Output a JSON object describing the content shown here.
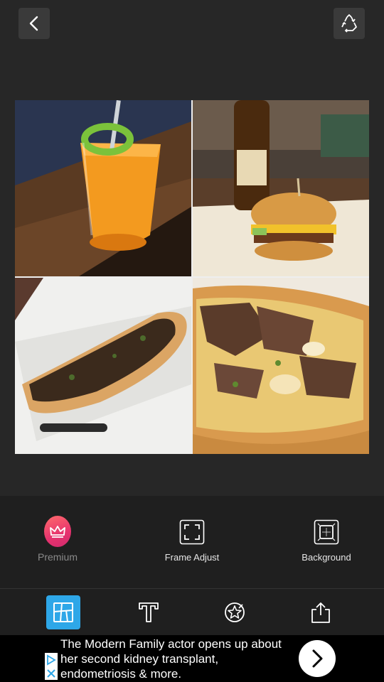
{
  "topbar": {
    "back_icon": "chevron-left-icon",
    "recycle_icon": "recycle-icon"
  },
  "collage": {
    "photos": [
      {
        "subject": "orange cocktail with lime garnish"
      },
      {
        "subject": "cheeseburger with beer bottle"
      },
      {
        "subject": "cheesesteak sandwich in takeout box"
      },
      {
        "subject": "philly cheesesteak close-up"
      }
    ]
  },
  "toolbar": {
    "premium_label": "Premium",
    "frame_adjust_label": "Frame Adjust",
    "background_label": "Background"
  },
  "tabs": {
    "active": "layout",
    "items": [
      "layout-icon",
      "text-icon",
      "sticker-icon",
      "share-icon"
    ]
  },
  "ad": {
    "text": "The Modern Family actor opens up about her second kidney transplant, endometriosis & more."
  },
  "colors": {
    "background": "#272727",
    "panel": "#1f1f1f",
    "accent": "#2ea7e8",
    "premium_gradient_start": "#ff6b6b",
    "premium_gradient_end": "#d12a6d"
  }
}
